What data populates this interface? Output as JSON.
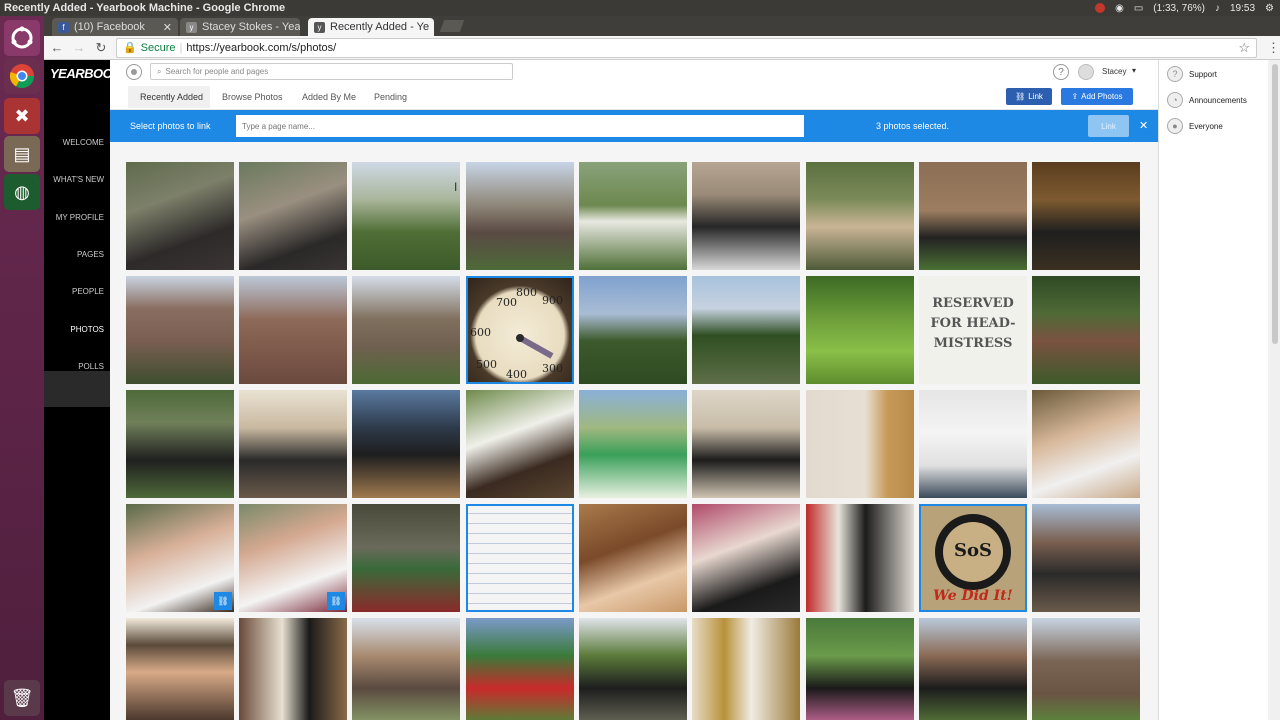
{
  "os": {
    "window_title": "Recently Added - Yearbook Machine - Google Chrome",
    "battery": "(1:33, 76%)",
    "time": "19:53"
  },
  "browser": {
    "tabs": [
      {
        "label": "(10) Facebook"
      },
      {
        "label": "Stacey Stokes - Yea"
      },
      {
        "label": "Recently Added - Ye"
      }
    ],
    "secure_label": "Secure",
    "url": "https://yearbook.com/s/photos/"
  },
  "app": {
    "logo": "YEARBOOK",
    "nav": [
      "WELCOME",
      "WHAT'S NEW",
      "MY PROFILE",
      "PAGES",
      "PEOPLE",
      "PHOTOS",
      "POLLS"
    ],
    "search_placeholder": "Search for people and pages",
    "user_name": "Stacey",
    "subnav": [
      "Recently Added",
      "Browse Photos",
      "Added By Me",
      "Pending"
    ],
    "link_button": "Link",
    "add_photos_button": "Add Photos"
  },
  "link_bar": {
    "label": "Select photos to link",
    "input_placeholder": "Type a page name...",
    "selected_count": "3 photos selected.",
    "link_button": "Link"
  },
  "photos": {
    "reserved_sign": "RESERVED FOR HEAD-MISTRESS",
    "sos_logo": "SoS",
    "we_did_it": "We Did It!"
  },
  "right_panel": {
    "items": [
      "Support",
      "Announcements",
      "Everyone"
    ]
  }
}
